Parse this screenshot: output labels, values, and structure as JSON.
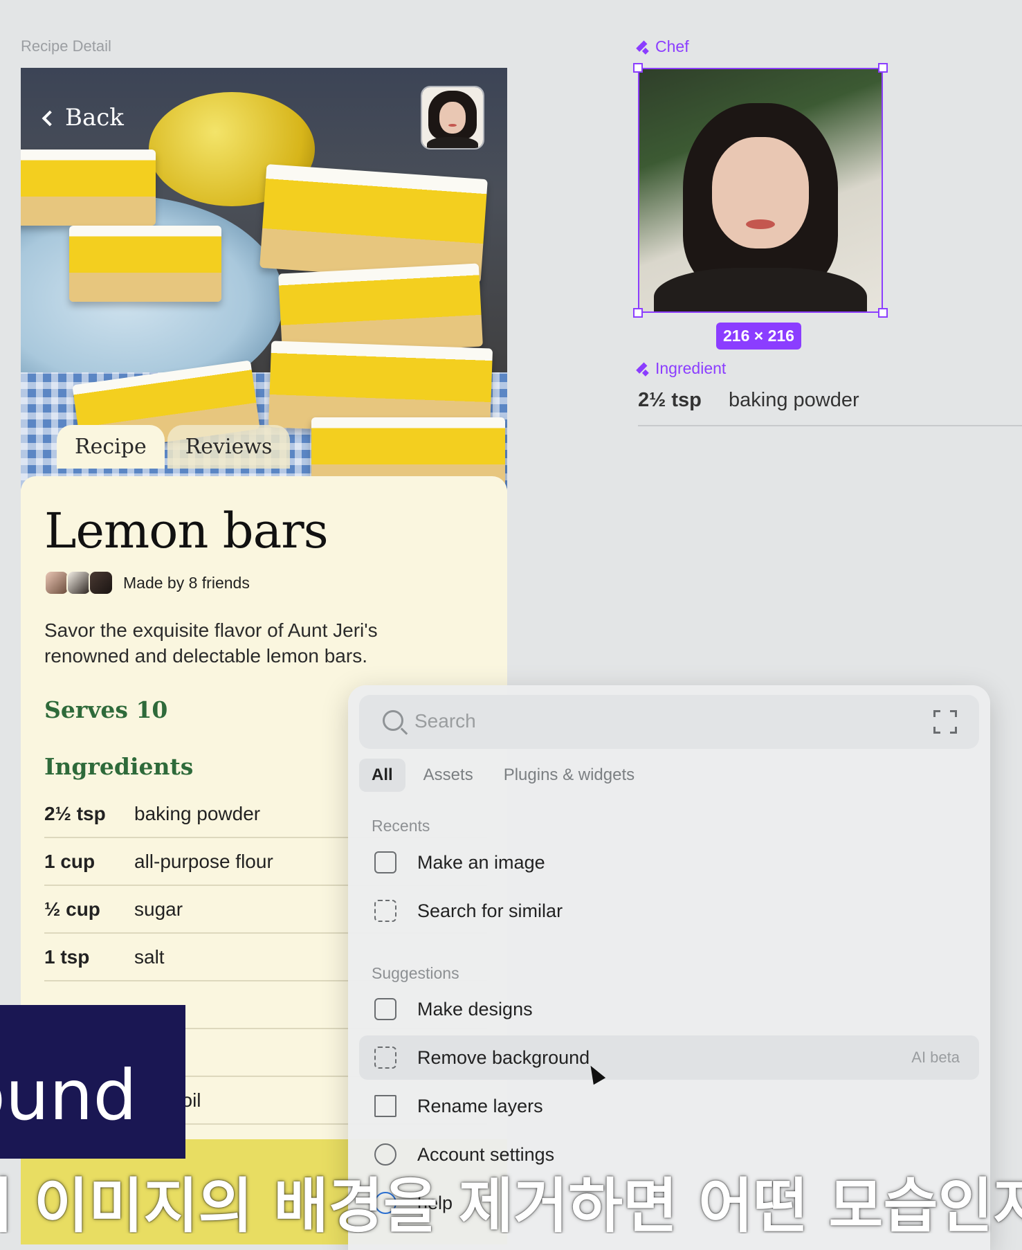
{
  "canvas": {
    "frame_label": "Recipe Detail"
  },
  "recipe": {
    "back_label": "Back",
    "tabs": [
      "Recipe",
      "Reviews"
    ],
    "title": "Lemon bars",
    "made_by": "Made by 8 friends",
    "description": "Savor the exquisite flavor of Aunt Jeri's renowned and delectable lemon bars.",
    "serves": "Serves 10",
    "ingredients_heading": "Ingredients",
    "ingredients": [
      {
        "qty": "2½ tsp",
        "name": "baking powder"
      },
      {
        "qty": "1 cup",
        "name": "all-purpose flour"
      },
      {
        "qty": "½ cup",
        "name": "sugar"
      },
      {
        "qty": "1 tsp",
        "name": "salt"
      },
      {
        "qty": "",
        "name": ""
      },
      {
        "qty": "",
        "name": ""
      },
      {
        "qty": "",
        "name": "table oil"
      }
    ]
  },
  "components": {
    "chef_label": "Chef",
    "chef_size": "216 × 216",
    "ingredient_label": "Ingredient",
    "ingredient_sample": {
      "qty": "2½ tsp",
      "name": "baking powder"
    },
    "accent_color": "#8b3dff"
  },
  "actions_panel": {
    "search_placeholder": "Search",
    "tabs": [
      "All",
      "Assets",
      "Plugins & widgets"
    ],
    "recents_label": "Recents",
    "recents": [
      {
        "label": "Make an image",
        "icon": "image-sparkle-icon"
      },
      {
        "label": "Search for similar",
        "icon": "scan-similar-icon"
      }
    ],
    "suggestions_label": "Suggestions",
    "suggestions": [
      {
        "label": "Make designs",
        "icon": "layout-sparkle-icon",
        "tag": ""
      },
      {
        "label": "Remove background",
        "icon": "remove-bg-icon",
        "tag": "AI beta"
      },
      {
        "label": "Rename layers",
        "icon": "rename-icon",
        "tag": ""
      },
      {
        "label": "Account settings",
        "icon": "gear-icon",
        "tag": ""
      },
      {
        "label": "help",
        "icon": "help-icon",
        "tag": ""
      }
    ]
  },
  "video_overlay": {
    "caption_fragment": "ound",
    "subtitle": "저 이미지의 배경을 제거하면 어떤 모습인지"
  }
}
